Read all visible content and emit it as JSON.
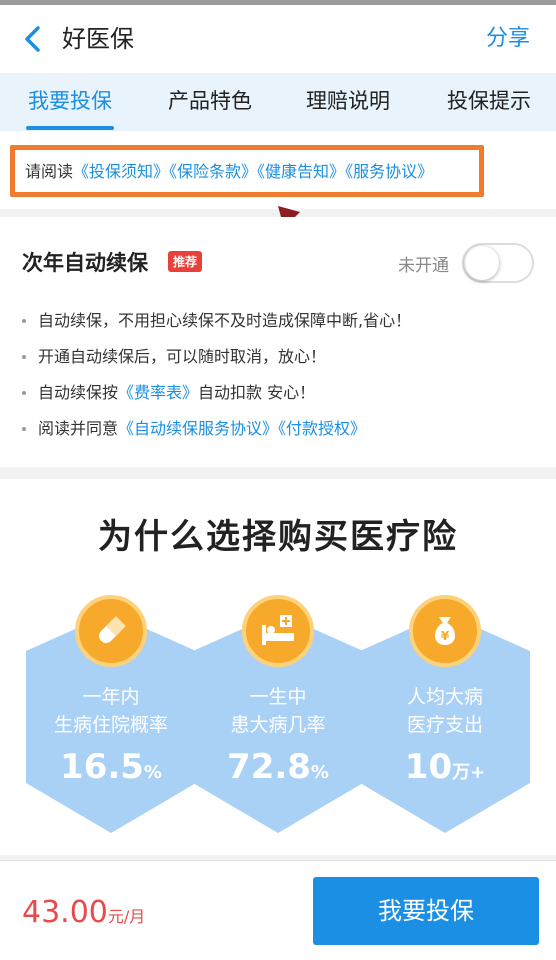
{
  "header": {
    "title": "好医保",
    "share_label": "分享"
  },
  "tabs": [
    {
      "label": "我要投保",
      "active": true
    },
    {
      "label": "产品特色",
      "active": false
    },
    {
      "label": "理赔说明",
      "active": false
    },
    {
      "label": "投保提示",
      "active": false
    }
  ],
  "notice": {
    "prefix": "请阅读",
    "links": [
      "《投保须知》",
      "《保险条款》",
      "《健康告知》",
      "《服务协议》"
    ]
  },
  "renew": {
    "title": "次年自动续保",
    "badge": "推荐",
    "toggle_label": "未开通",
    "toggle_on": false,
    "bullet1": "自动续保，不用担心续保不及时造成保障中断,省心！",
    "bullet2": "开通自动续保后，可以随时取消，放心！",
    "bullet3_prefix": "自动续保按",
    "bullet3_link": "《费率表》",
    "bullet3_suffix": "自动扣款 安心！",
    "bullet4_prefix": "阅读并同意",
    "bullet4_link1": "《自动续保服务协议》",
    "bullet4_link2": "《付款授权》"
  },
  "why": {
    "title": "为什么选择购买医疗险",
    "cards": [
      {
        "line1": "一年内",
        "line2": "生病住院概率",
        "value": "16.5",
        "unit": "%",
        "icon": "pill-icon"
      },
      {
        "line1": "一生中",
        "line2": "患大病几率",
        "value": "72.8",
        "unit": "%",
        "icon": "hospital-bed-icon"
      },
      {
        "line1": "人均大病",
        "line2": "医疗支出",
        "value": "10",
        "unit": "万+",
        "icon": "money-bag-icon"
      }
    ]
  },
  "footer": {
    "price": "43.00",
    "price_unit": "元/月",
    "buy_label": "我要投保"
  },
  "colors": {
    "accent": "#1a8fe3",
    "highlight": "#f07b2c",
    "card": "#a9d0f5",
    "icon_bg": "#f7a92c",
    "price": "#e84a4a"
  }
}
